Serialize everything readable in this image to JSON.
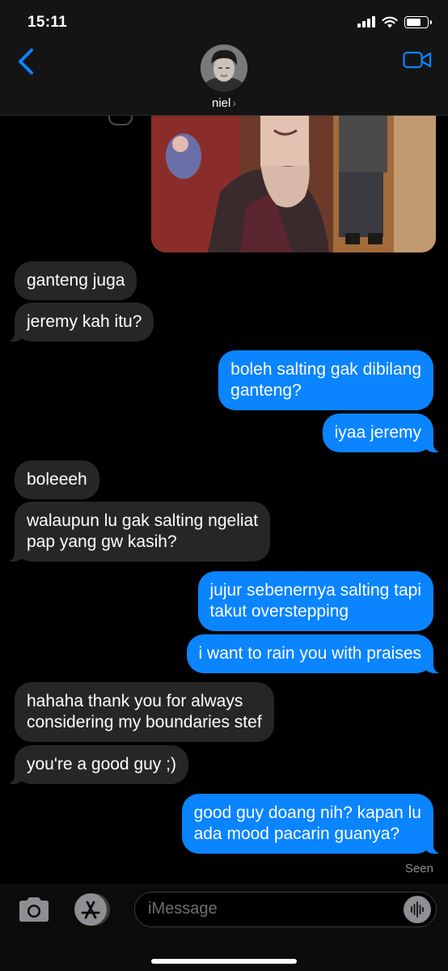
{
  "status_bar": {
    "time": "15:11",
    "battery_level": 0.7
  },
  "header": {
    "contact_name": "niel",
    "chevron": "›"
  },
  "icons": {
    "back": "chevron-left-icon",
    "video": "video-camera-icon",
    "camera": "camera-icon",
    "apps": "app-store-icon",
    "audio": "audio-waveform-icon"
  },
  "messages": [
    {
      "dir": "in",
      "text": "ganteng juga",
      "tail": false
    },
    {
      "dir": "in",
      "text": "jeremy kah itu?",
      "tail": true
    },
    {
      "dir": "out",
      "lines": [
        "boleh salting gak dibilang",
        "ganteng?"
      ],
      "tail": false
    },
    {
      "dir": "out",
      "text": "iyaa jeremy",
      "tail": true
    },
    {
      "dir": "in",
      "text": "boleeeh",
      "tail": false
    },
    {
      "dir": "in",
      "lines": [
        "walaupun lu gak salting ngeliat",
        "pap yang gw kasih?"
      ],
      "tail": true
    },
    {
      "dir": "out",
      "lines": [
        "jujur sebenernya salting tapi",
        "takut overstepping"
      ],
      "tail": false
    },
    {
      "dir": "out",
      "text": "i want to rain you with praises",
      "tail": true
    },
    {
      "dir": "in",
      "lines": [
        "hahaha thank you for always",
        "considering my boundaries stef"
      ],
      "tail": false
    },
    {
      "dir": "in",
      "text": "you're a good guy ;)",
      "tail": true
    },
    {
      "dir": "out",
      "lines": [
        "good guy doang nih? kapan lu",
        "ada mood pacarin guanya?"
      ],
      "tail": true
    }
  ],
  "seen_label": "Seen",
  "input": {
    "placeholder": "iMessage"
  },
  "colors": {
    "outgoing": "#0a84ff",
    "incoming": "#262628",
    "accent": "#0a84ff"
  }
}
